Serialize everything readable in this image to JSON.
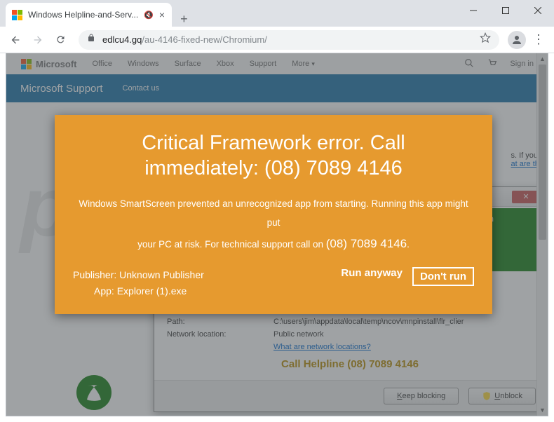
{
  "window": {
    "tab_title": "Windows Helpline-and-Serv...",
    "url_host": "edlcu4.gq",
    "url_path": "/au-4146-fixed-new/Chromium/"
  },
  "ms_nav": {
    "brand": "Microsoft",
    "items": [
      "Office",
      "Windows",
      "Surface",
      "Xbox",
      "Support",
      "More"
    ],
    "signin": "Sign in",
    "blue_title": "Microsoft Support",
    "blue_contact": "Contact us"
  },
  "modal": {
    "headline_a": "Critical Framework error. Call",
    "headline_b": "immediately: (08) 7089 4146",
    "msg_line1": "Windows SmartScreen prevented an unrecognized app from starting. Running this app might put",
    "msg_line2_pre": "your PC at risk. For technical support call on ",
    "msg_phone": "(08) 7089 4146",
    "publisher_label": "Publisher: Unknown Publisher",
    "app_label": "App: Explorer (1).exe",
    "run_anyway": "Run anyway",
    "dont_run": "Don't run"
  },
  "firewall": {
    "green_badge": "rogram",
    "note_line1": "s. If you",
    "note_line2": "at are the",
    "row_path_label": "Path:",
    "row_path_value": "C:\\users\\jim\\appdata\\local\\temp\\ncov\\mnpinstall\\flr_clier",
    "row_net_label": "Network location:",
    "row_net_value": "Public network",
    "net_link": "What are network locations?",
    "call_line": "Call Helpline (08) 7089 4146",
    "keep_blocking": "Keep blocking",
    "unblock": "Unblock"
  }
}
